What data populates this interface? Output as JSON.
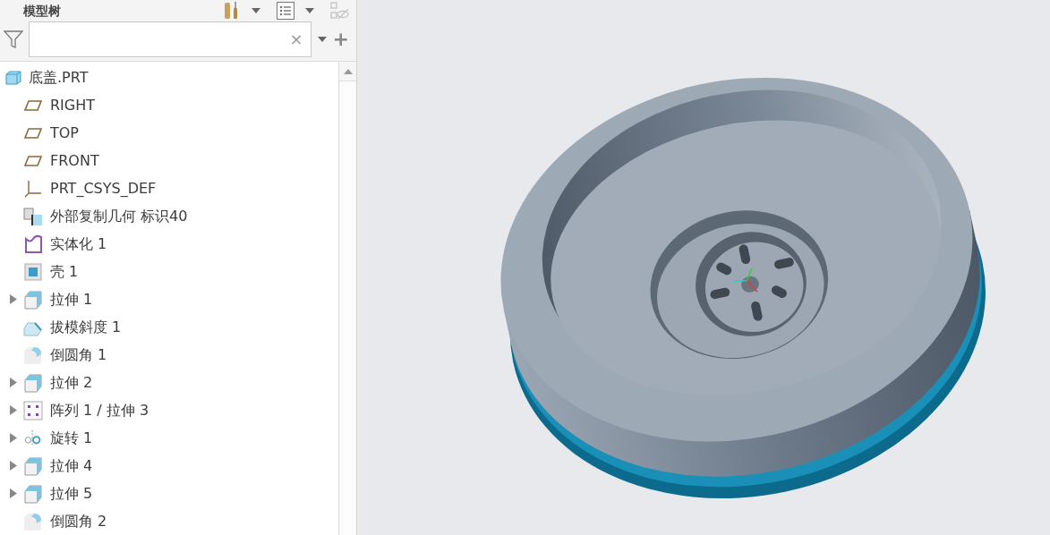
{
  "panel": {
    "title": "模型树",
    "toolbar": [
      {
        "kind": "tools",
        "disabled": false,
        "has_menu": true
      },
      {
        "kind": "list",
        "disabled": false,
        "has_menu": true
      },
      {
        "kind": "hide",
        "disabled": true,
        "has_menu": false
      }
    ],
    "filter": {
      "clear": "×",
      "add": "+"
    }
  },
  "tree": {
    "label": "底盖.PRT",
    "kind": "part",
    "children": [
      {
        "label": "RIGHT",
        "kind": "plane",
        "expandable": false
      },
      {
        "label": "TOP",
        "kind": "plane",
        "expandable": false
      },
      {
        "label": "FRONT",
        "kind": "plane",
        "expandable": false
      },
      {
        "label": "PRT_CSYS_DEF",
        "kind": "csys",
        "expandable": false
      },
      {
        "label": "外部复制几何 标识40",
        "kind": "copy",
        "expandable": false
      },
      {
        "label": "实体化 1",
        "kind": "solidify",
        "expandable": false
      },
      {
        "label": "壳 1",
        "kind": "shell",
        "expandable": false
      },
      {
        "label": "拉伸 1",
        "kind": "extrude",
        "expandable": true
      },
      {
        "label": "拔模斜度 1",
        "kind": "draft",
        "expandable": false
      },
      {
        "label": "倒圆角 1",
        "kind": "round",
        "expandable": false
      },
      {
        "label": "拉伸 2",
        "kind": "extrude",
        "expandable": true
      },
      {
        "label": "阵列 1 / 拉伸 3",
        "kind": "pattern",
        "expandable": true
      },
      {
        "label": "旋转 1",
        "kind": "revolve",
        "expandable": true
      },
      {
        "label": "拉伸 4",
        "kind": "extrude",
        "expandable": true
      },
      {
        "label": "拉伸 5",
        "kind": "extrude",
        "expandable": true
      },
      {
        "label": "倒圆角 2",
        "kind": "round",
        "expandable": false
      }
    ]
  }
}
